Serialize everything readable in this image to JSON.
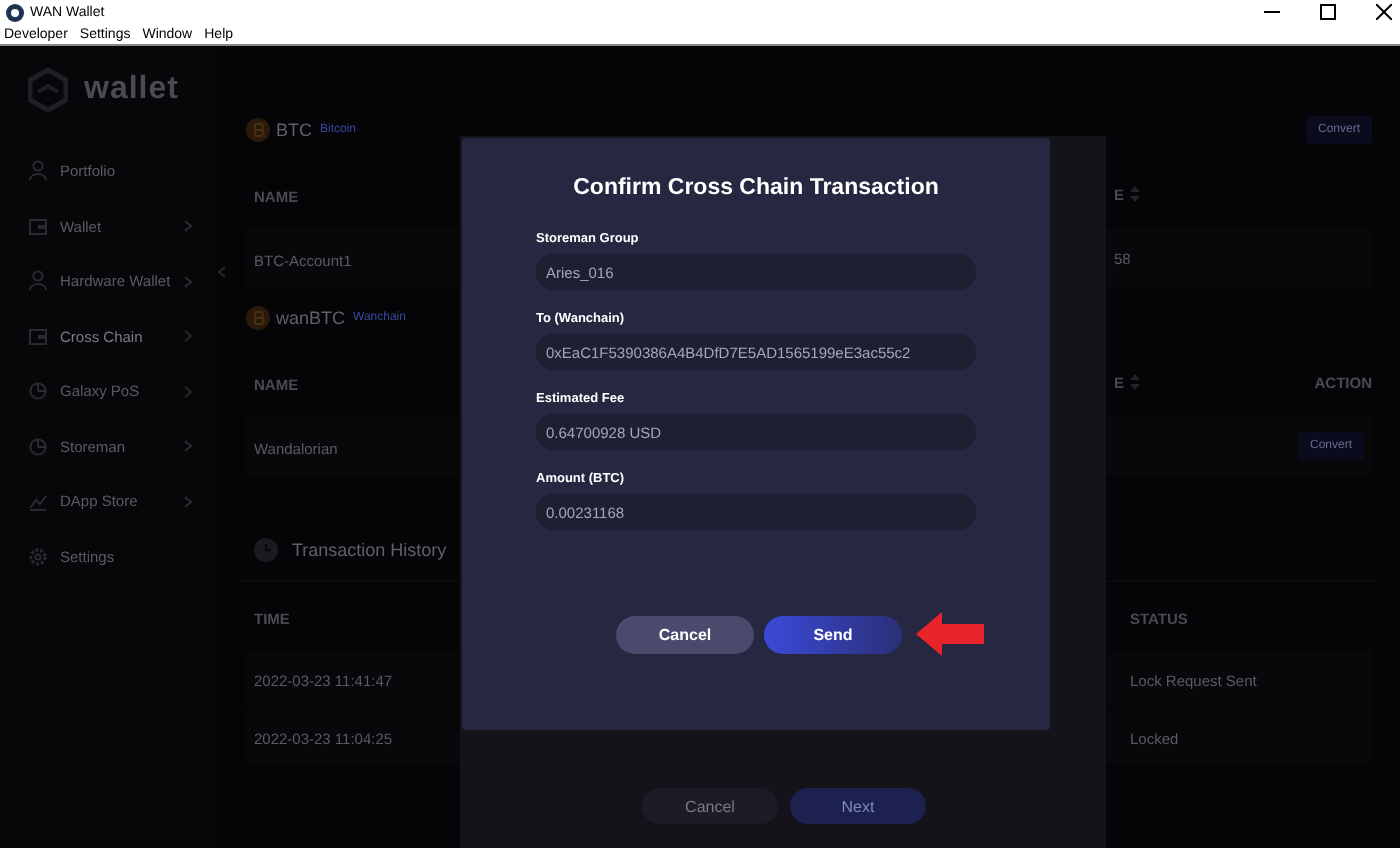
{
  "window": {
    "title": "WAN Wallet"
  },
  "menu": [
    "Developer",
    "Settings",
    "Window",
    "Help"
  ],
  "sidebar": {
    "logo": "wallet",
    "items": [
      {
        "label": "Portfolio",
        "kind": "person",
        "has_submenu": false,
        "selected": false
      },
      {
        "label": "Wallet",
        "kind": "wallet",
        "has_submenu": true,
        "selected": false
      },
      {
        "label": "Hardware Wallet",
        "kind": "person",
        "has_submenu": true,
        "selected": false
      },
      {
        "label": "Cross Chain",
        "kind": "wallet",
        "has_submenu": true,
        "selected": true
      },
      {
        "label": "Galaxy PoS",
        "kind": "pie",
        "has_submenu": true,
        "selected": false
      },
      {
        "label": "Storeman",
        "kind": "pie",
        "has_submenu": true,
        "selected": false
      },
      {
        "label": "DApp Store",
        "kind": "chart",
        "has_submenu": true,
        "selected": false
      },
      {
        "label": "Settings",
        "kind": "gear",
        "has_submenu": false,
        "selected": false
      }
    ]
  },
  "sections": [
    {
      "symbol": "BTC",
      "chain": "Bitcoin",
      "button": "Convert",
      "columns": [
        {
          "label": "NAME",
          "sortable": false
        },
        {
          "label": "E",
          "sortable": true
        }
      ],
      "rows": [
        {
          "name": "BTC-Account1",
          "balance": "58"
        }
      ]
    },
    {
      "symbol": "wanBTC",
      "chain": "Wanchain",
      "columns": [
        {
          "label": "NAME",
          "sortable": false
        },
        {
          "label": "E",
          "sortable": true
        },
        {
          "label": "ACTION",
          "sortable": false
        }
      ],
      "rows": [
        {
          "name": "Wandalorian",
          "action": "Convert"
        }
      ]
    }
  ],
  "history": {
    "title": "Transaction History",
    "columns": [
      "TIME",
      "STATUS"
    ],
    "rows": [
      {
        "time": "2022-03-23 11:41:47",
        "status": "Lock Request Sent"
      },
      {
        "time": "2022-03-23 11:04:25",
        "status": "Locked"
      }
    ]
  },
  "back_dialog": {
    "buttons": [
      {
        "label": "Cancel",
        "kind": "secondary"
      },
      {
        "label": "Next",
        "kind": "primary"
      }
    ]
  },
  "dialog": {
    "title": "Confirm Cross Chain Transaction",
    "fields": [
      {
        "label": "Storeman Group",
        "value": "Aries_016"
      },
      {
        "label": "To (Wanchain)",
        "value": "0xEaC1F5390386A4B4DfD7E5AD1565199eE3ac55c2"
      },
      {
        "label": "Estimated Fee",
        "value": "0.64700928 USD"
      },
      {
        "label": "Amount (BTC)",
        "value": "0.00231168"
      }
    ],
    "buttons": [
      {
        "label": "Cancel",
        "kind": "secondary"
      },
      {
        "label": "Send",
        "kind": "primary"
      }
    ]
  }
}
